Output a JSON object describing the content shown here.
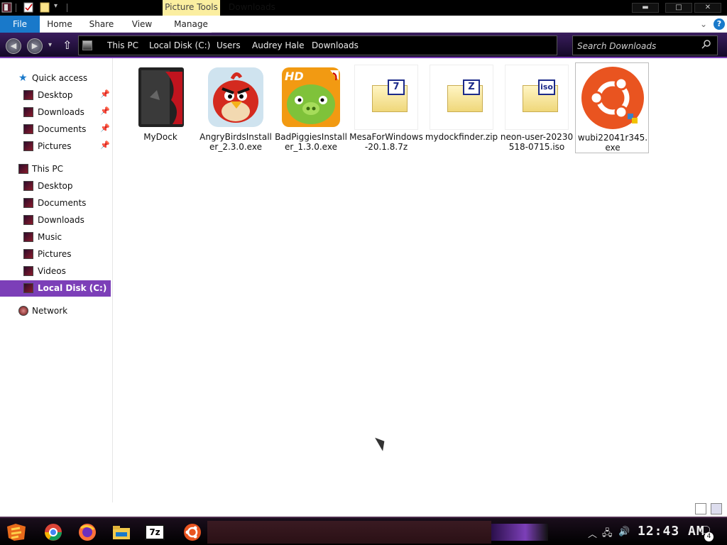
{
  "titlebar": {
    "context_tab": "Picture Tools",
    "title": "Downloads",
    "minimize": "▬",
    "maximize": "□",
    "close": "✕"
  },
  "ribbon": {
    "tabs": [
      "File",
      "Home",
      "Share",
      "View",
      "Manage"
    ],
    "help": "?"
  },
  "addressbar": {
    "breadcrumbs": [
      "This PC",
      "Local Disk (C:)",
      "Users",
      "Audrey Hale",
      "Downloads"
    ],
    "search_placeholder": "Search Downloads"
  },
  "navpane": {
    "quick_access": "Quick access",
    "quick_items": [
      "Desktop",
      "Downloads",
      "Documents",
      "Pictures"
    ],
    "this_pc": "This PC",
    "pc_items": [
      "Desktop",
      "Documents",
      "Downloads",
      "Music",
      "Pictures",
      "Videos"
    ],
    "local_disk": "Local Disk (C:)",
    "network": "Network"
  },
  "files": [
    {
      "name": "MyDock",
      "icon": "dock-folder-icon"
    },
    {
      "name": "AngryBirdsInstaller_2.3.0.exe",
      "icon": "angry-birds-icon"
    },
    {
      "name": "BadPiggiesInstaller_1.3.0.exe",
      "icon": "bad-piggies-icon",
      "badge": "HD"
    },
    {
      "name": "MesaForWindows-20.1.8.7z",
      "icon": "archive-7z-icon",
      "badge": "7"
    },
    {
      "name": "mydockfinder.zip",
      "icon": "archive-zip-icon",
      "badge": "Z"
    },
    {
      "name": "neon-user-20230518-0715.iso",
      "icon": "archive-iso-icon",
      "badge": "iso"
    },
    {
      "name": "wubi22041r345.exe",
      "icon": "ubuntu-icon"
    }
  ],
  "taskbar": {
    "clock": "12:43 AM",
    "notification_count": "4",
    "apps": [
      "start-icon",
      "chrome-icon",
      "firefox-icon",
      "file-explorer-icon",
      "7zip-icon",
      "ubuntu-icon"
    ],
    "sevenzip_label": "7z"
  },
  "colors": {
    "accent": "#7c3fb8",
    "file_tab": "#1979ca",
    "context_tab": "#fbeea0"
  }
}
